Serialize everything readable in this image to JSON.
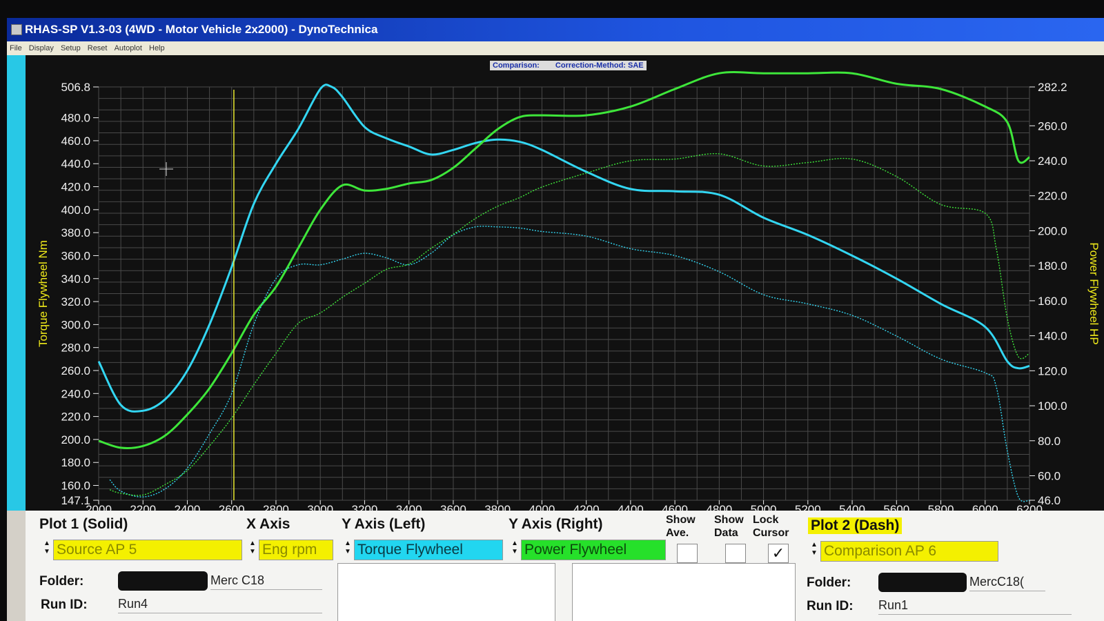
{
  "window": {
    "title": "RHAS-SP V1.3-03  (4WD - Motor Vehicle 2x2000) - DynoTechnica"
  },
  "menu": [
    "File",
    "Display",
    "Setup",
    "Reset",
    "Autoplot",
    "Help"
  ],
  "comparison_bar": {
    "comparison": "Comparison:",
    "correction": "Correction-Method: SAE"
  },
  "colors": {
    "torque": "#33d6f2",
    "power": "#3ee63a",
    "cursor": "#e8e830",
    "axis_text": "#f0f0f0",
    "axis_title": "#f0ea1a",
    "grid": "#4a4a4a"
  },
  "chart_data": {
    "type": "line",
    "xlabel": "",
    "ylabel": "Torque Flywheel Nm",
    "ylabel_right": "Power Flywheel HP",
    "xlim": [
      2000,
      6200
    ],
    "ylim": [
      147.1,
      506.8
    ],
    "ylim_right": [
      46.0,
      282.2
    ],
    "x_ticks": [
      "2000",
      "2200",
      "2400",
      "2600",
      "2800",
      "3000",
      "3200",
      "3400",
      "3600",
      "3800",
      "4000",
      "4200",
      "4400",
      "4600",
      "4800",
      "5000",
      "5200",
      "5400",
      "5600",
      "5800",
      "6000",
      "6200"
    ],
    "y_ticks_left": [
      "506.8",
      "480.0",
      "460.0",
      "440.0",
      "420.0",
      "400.0",
      "380.0",
      "360.0",
      "340.0",
      "320.0",
      "300.0",
      "280.0",
      "260.0",
      "240.0",
      "220.0",
      "200.0",
      "180.0",
      "160.0",
      "147.1"
    ],
    "y_ticks_right": [
      "282.2",
      "260.0",
      "240.0",
      "220.0",
      "200.0",
      "180.0",
      "160.0",
      "140.0",
      "120.0",
      "100.0",
      "80.0",
      "60.0",
      "46.0"
    ],
    "grid": true,
    "cursor_x": 2610,
    "series": [
      {
        "name": "Torque Flywheel",
        "style": "solid",
        "axis": "left",
        "x": [
          2000,
          2100,
          2200,
          2300,
          2400,
          2500,
          2600,
          2700,
          2800,
          2900,
          3000,
          3050,
          3100,
          3200,
          3300,
          3400,
          3500,
          3600,
          3700,
          3800,
          3900,
          4000,
          4200,
          4400,
          4600,
          4800,
          5000,
          5200,
          5400,
          5600,
          5800,
          6000,
          6100,
          6150,
          6200
        ],
        "y": [
          268,
          230,
          225,
          235,
          260,
          300,
          350,
          405,
          440,
          470,
          505,
          507,
          498,
          472,
          462,
          455,
          448,
          452,
          458,
          461,
          459,
          452,
          433,
          418,
          416,
          413,
          393,
          378,
          360,
          340,
          318,
          298,
          268,
          262,
          264
        ]
      },
      {
        "name": "Power Flywheel",
        "style": "solid",
        "axis": "right",
        "x": [
          2000,
          2100,
          2200,
          2300,
          2400,
          2500,
          2600,
          2700,
          2800,
          2900,
          3000,
          3100,
          3200,
          3300,
          3400,
          3500,
          3600,
          3700,
          3800,
          3900,
          4000,
          4200,
          4400,
          4600,
          4800,
          5000,
          5200,
          5400,
          5600,
          5800,
          6000,
          6100,
          6150,
          6200
        ],
        "y": [
          80,
          76,
          77,
          83,
          95,
          110,
          130,
          152,
          168,
          190,
          212,
          226,
          223,
          224,
          227,
          229,
          236,
          247,
          258,
          265,
          266,
          266,
          271,
          281,
          290,
          290,
          290,
          290,
          284,
          281,
          271,
          262,
          240,
          242
        ]
      },
      {
        "name": "Torque Flywheel (Comparison)",
        "style": "dash",
        "axis": "left",
        "x": [
          2050,
          2100,
          2200,
          2300,
          2400,
          2500,
          2600,
          2700,
          2800,
          2900,
          3000,
          3100,
          3200,
          3300,
          3400,
          3500,
          3600,
          3700,
          3800,
          3900,
          4000,
          4200,
          4400,
          4600,
          4800,
          5000,
          5200,
          5400,
          5600,
          5800,
          6000,
          6050,
          6100,
          6150,
          6200
        ],
        "y": [
          165,
          155,
          150,
          157,
          175,
          205,
          240,
          300,
          340,
          352,
          352,
          357,
          362,
          358,
          352,
          362,
          378,
          385,
          385,
          384,
          381,
          377,
          366,
          360,
          346,
          326,
          318,
          308,
          290,
          270,
          258,
          246,
          190,
          150,
          147
        ]
      },
      {
        "name": "Power Flywheel (Comparison)",
        "style": "dash",
        "axis": "right",
        "x": [
          2050,
          2100,
          2200,
          2300,
          2400,
          2500,
          2600,
          2700,
          2800,
          2900,
          3000,
          3100,
          3200,
          3300,
          3400,
          3500,
          3600,
          3700,
          3800,
          3900,
          4000,
          4200,
          4400,
          4600,
          4800,
          5000,
          5200,
          5400,
          5600,
          5800,
          6000,
          6050,
          6100,
          6150,
          6200
        ],
        "y": [
          52,
          50,
          49,
          55,
          63,
          77,
          93,
          112,
          130,
          147,
          153,
          162,
          170,
          178,
          181,
          190,
          198,
          207,
          214,
          219,
          225,
          233,
          240,
          241,
          244,
          237,
          239,
          241,
          231,
          215,
          210,
          190,
          150,
          128,
          130
        ]
      }
    ]
  },
  "panel": {
    "plot1_label": "Plot 1 (Solid)",
    "xaxis_label": "X Axis",
    "yaxis_left_label": "Y Axis (Left)",
    "yaxis_right_label": "Y Axis (Right)",
    "show_ave_label": "Show Ave.",
    "show_data_label": "Show Data",
    "lock_cursor_label": "Lock Cursor",
    "plot2_label": "Plot 2 (Dash)",
    "source_value": "Source AP 5",
    "xaxis_value": "Eng rpm",
    "yaxis_left_value": "Torque Flywheel",
    "yaxis_right_value": "Power Flywheel",
    "comparison_value": "Comparison AP 6",
    "folder_label": "Folder:",
    "runid_label": "Run ID:",
    "plot1_folder": "Merc C18",
    "plot1_runid": "Run4",
    "plot2_folder": "MercC18(",
    "plot2_runid": "Run1",
    "show_ave_checked": false,
    "show_data_checked": false,
    "lock_cursor_checked": true,
    "check_mark": "✓"
  }
}
